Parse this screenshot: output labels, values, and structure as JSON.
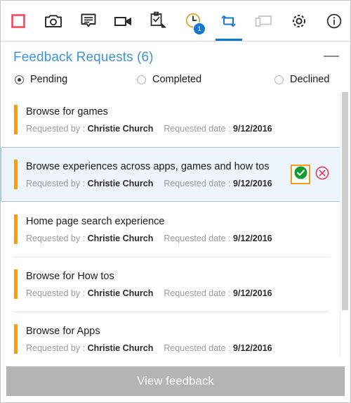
{
  "toolbar": {
    "groups": [
      {
        "buttons": [
          {
            "name": "stop-recording-icon",
            "label": "Stop",
            "color": "#f9465c"
          }
        ]
      },
      {
        "buttons": [
          {
            "name": "camera-icon",
            "label": "Screenshot",
            "color": "#2b2b2b"
          },
          {
            "name": "comment-icon",
            "label": "Comment",
            "color": "#2b2b2b"
          },
          {
            "name": "video-camera-icon",
            "label": "Record video",
            "color": "#2b2b2b"
          }
        ]
      },
      {
        "buttons": [
          {
            "name": "clipboard-check-icon",
            "label": "Test case",
            "color": "#2b2b2b"
          },
          {
            "name": "clock-icon",
            "label": "Pending",
            "color": "#e8a33d",
            "badge": "1"
          },
          {
            "name": "sync-arrows-icon",
            "label": "Feedback requests",
            "color": "#1477d4",
            "active": true
          }
        ]
      },
      {
        "buttons": [
          {
            "name": "screen-devices-icon",
            "label": "Devices",
            "color": "#c9c9c9"
          },
          {
            "name": "gear-icon",
            "label": "Settings",
            "color": "#2b2b2b"
          }
        ]
      },
      {
        "buttons": [
          {
            "name": "info-icon",
            "label": "Info",
            "color": "#2b2b2b"
          }
        ]
      }
    ]
  },
  "panel": {
    "title": "Feedback Requests (6)",
    "minimize_label": "Minimize",
    "filters": [
      {
        "label": "Pending",
        "selected": true
      },
      {
        "label": "Completed",
        "selected": false
      },
      {
        "label": "Declined",
        "selected": false
      }
    ],
    "meta_labels": {
      "requested_by": "Requested by :",
      "requested_date": "Requested date :"
    },
    "requests": [
      {
        "title": "Browse for games",
        "requested_by": "Christie Church",
        "requested_date": "9/12/2016",
        "selected": false
      },
      {
        "title": "Browse experiences across apps, games and how tos",
        "requested_by": "Christie Church",
        "requested_date": "9/12/2016",
        "selected": true,
        "accept_label": "Accept",
        "decline_label": "Decline"
      },
      {
        "title": "Home page search experience",
        "requested_by": "Christie Church",
        "requested_date": "9/12/2016",
        "selected": false
      },
      {
        "title": "Browse for How tos",
        "requested_by": "Christie Church",
        "requested_date": "9/12/2016",
        "selected": false
      },
      {
        "title": "Browse for Apps",
        "requested_by": "Christie Church",
        "requested_date": "9/12/2016",
        "selected": false
      }
    ],
    "footer_button": "View feedback"
  },
  "colors": {
    "accent_orange": "#f0a01e",
    "title_blue": "#3e94dd",
    "active_tab_blue": "#0b78d0",
    "badge_blue": "#1477d4",
    "accept_green": "#0f9d2f",
    "decline_red": "#e8384f",
    "selected_row_bg": "#eff5fc",
    "footer_gray": "#b4b4b4"
  }
}
